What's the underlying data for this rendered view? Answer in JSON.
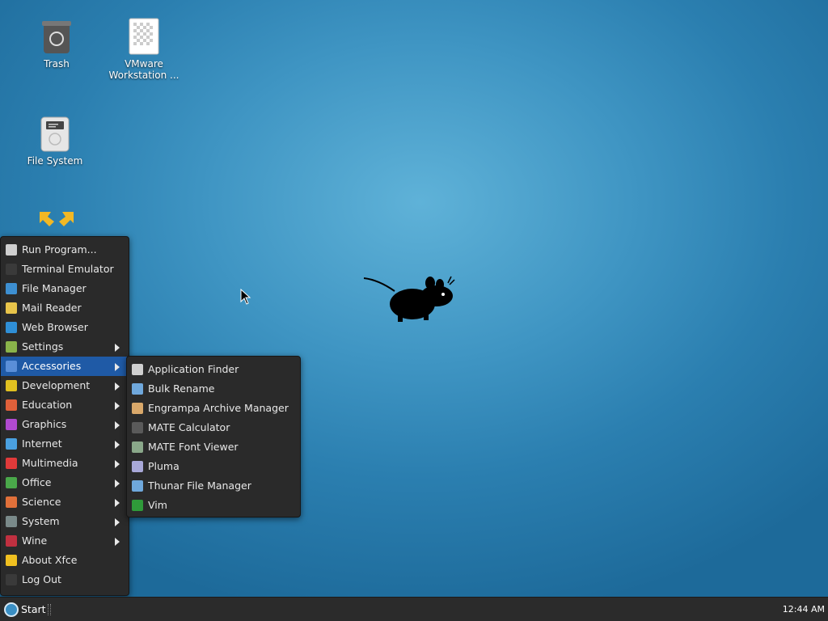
{
  "desktop": {
    "icons": [
      {
        "label": "Trash",
        "icon": "trash-icon"
      },
      {
        "label": "VMware Workstation ...",
        "icon": "document-icon"
      },
      {
        "label": "File System",
        "icon": "drive-icon"
      },
      {
        "label": "",
        "icon": "home-folder-icon"
      }
    ],
    "wallpaper_mascot": "xfce-mouse-icon"
  },
  "main_menu": {
    "items": [
      {
        "label": "Run Program...",
        "icon": "run-icon",
        "color": "#cfcfcf",
        "submenu": false
      },
      {
        "label": "Terminal Emulator",
        "icon": "terminal-icon",
        "color": "#3a3a3a",
        "submenu": false
      },
      {
        "label": "File Manager",
        "icon": "file-manager-icon",
        "color": "#3d8fd1",
        "submenu": false
      },
      {
        "label": "Mail Reader",
        "icon": "mail-icon",
        "color": "#e8c44a",
        "submenu": false
      },
      {
        "label": "Web Browser",
        "icon": "globe-icon",
        "color": "#2f8fd6",
        "submenu": false
      },
      {
        "label": "Settings",
        "icon": "settings-icon",
        "color": "#8ab34a",
        "submenu": true
      },
      {
        "label": "Accessories",
        "icon": "accessories-icon",
        "color": "#5a8fd8",
        "submenu": true,
        "active": true
      },
      {
        "label": "Development",
        "icon": "development-icon",
        "color": "#e0c020",
        "submenu": true
      },
      {
        "label": "Education",
        "icon": "education-icon",
        "color": "#e0603a",
        "submenu": true
      },
      {
        "label": "Graphics",
        "icon": "graphics-icon",
        "color": "#b04ad0",
        "submenu": true
      },
      {
        "label": "Internet",
        "icon": "internet-icon",
        "color": "#4aa0e0",
        "submenu": true
      },
      {
        "label": "Multimedia",
        "icon": "multimedia-icon",
        "color": "#e03a3a",
        "submenu": true
      },
      {
        "label": "Office",
        "icon": "office-icon",
        "color": "#4aa84a",
        "submenu": true
      },
      {
        "label": "Science",
        "icon": "science-icon",
        "color": "#e0703a",
        "submenu": true
      },
      {
        "label": "System",
        "icon": "system-icon",
        "color": "#7a8a8a",
        "submenu": true
      },
      {
        "label": "Wine",
        "icon": "wine-icon",
        "color": "#c03040",
        "submenu": true
      },
      {
        "label": "About Xfce",
        "icon": "star-icon",
        "color": "#f0c020",
        "submenu": false
      },
      {
        "label": "Log Out",
        "icon": "logout-icon",
        "color": "#3a3a3a",
        "submenu": false
      }
    ]
  },
  "accessories_menu": {
    "items": [
      {
        "label": "Application Finder",
        "icon": "app-finder-icon",
        "color": "#cfcfcf"
      },
      {
        "label": "Bulk Rename",
        "icon": "folder-icon",
        "color": "#6fa8dc"
      },
      {
        "label": "Engrampa Archive Manager",
        "icon": "archive-icon",
        "color": "#d9a86a"
      },
      {
        "label": "MATE Calculator",
        "icon": "calculator-icon",
        "color": "#5a5a5a"
      },
      {
        "label": "MATE Font Viewer",
        "icon": "font-viewer-icon",
        "color": "#8aa88a"
      },
      {
        "label": "Pluma",
        "icon": "text-editor-icon",
        "color": "#a8a8d8"
      },
      {
        "label": "Thunar File Manager",
        "icon": "folder-icon",
        "color": "#6fa8dc"
      },
      {
        "label": "Vim",
        "icon": "vim-icon",
        "color": "#2f9a3a"
      }
    ]
  },
  "taskbar": {
    "start_label": "Start",
    "clock": "12:44 AM"
  }
}
